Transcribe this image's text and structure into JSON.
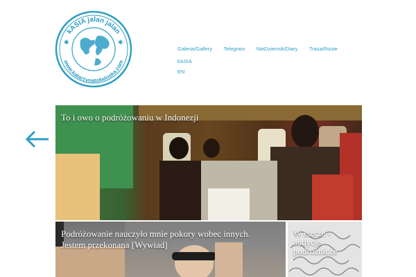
{
  "header": {
    "logo": {
      "text_top": "kASIA jalan jalan",
      "text_bottom": "www.katarzynatolwinska.com",
      "icon": "globe-logo",
      "color": "#2e9ec4"
    },
    "nav": {
      "items": [
        {
          "label": "Galeria/Gallery"
        },
        {
          "label": "Telegram"
        },
        {
          "label": "NieDziennik/Diary"
        },
        {
          "label": "Trasa/Route"
        },
        {
          "label": "kASIA"
        },
        {
          "label": "EN"
        }
      ]
    }
  },
  "carousel": {
    "prev_icon": "arrow-left-icon",
    "accent": "#2e9ec4"
  },
  "posts": [
    {
      "title": "To i owo o podróżowaniu w Indonezji"
    },
    {
      "title": "Podróżowanie nauczyło mnie pokory wobec innych. Jestem przekonana [Wywiad]"
    },
    {
      "title": "W eterze - audycje podróżnicze"
    }
  ]
}
